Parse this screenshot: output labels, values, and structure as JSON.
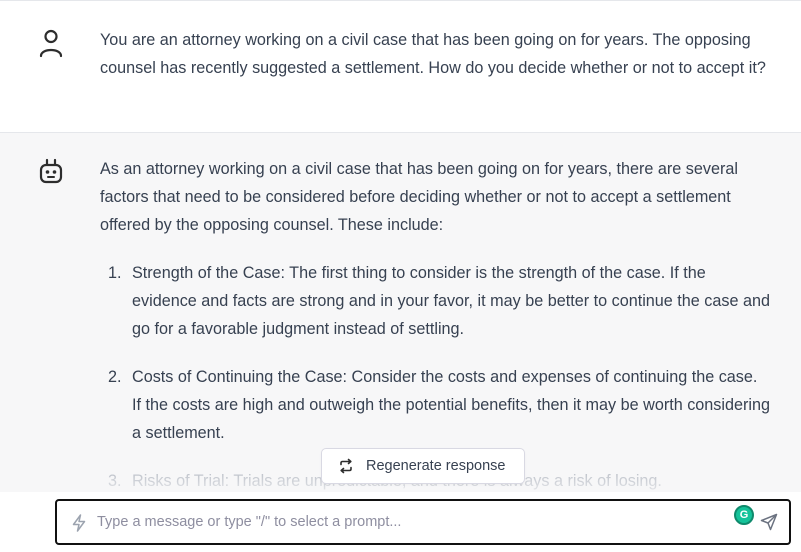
{
  "conversation": {
    "user_message": "You are an attorney working on a civil case that has been going on for years. The opposing counsel has recently suggested a settlement. How do you decide whether or not to accept it?",
    "assistant": {
      "intro": "As an attorney working on a civil case that has been going on for years, there are several factors that need to be considered before deciding whether or not to accept a settlement offered by the opposing counsel. These include:",
      "points": [
        {
          "num": "1.",
          "text": "Strength of the Case: The first thing to consider is the strength of the case. If the evidence and facts are strong and in your favor, it may be better to continue the case and go for a favorable judgment instead of settling."
        },
        {
          "num": "2.",
          "text": "Costs of Continuing the Case: Consider the costs and expenses of continuing the case. If the costs are high and outweigh the potential benefits, then it may be worth considering a settlement."
        },
        {
          "num": "3.",
          "text": "Risks of Trial: Trials are unpredictable, and there is always a risk of losing."
        }
      ]
    }
  },
  "controls": {
    "regenerate_label": "Regenerate response",
    "input_placeholder": "Type a message or type \"/\" to select a prompt...",
    "grammarly_letter": "G"
  },
  "icons": {
    "user": "user-icon",
    "bot": "robot-icon",
    "regenerate": "refresh-icon",
    "prompt": "bolt-icon",
    "send": "send-icon"
  }
}
